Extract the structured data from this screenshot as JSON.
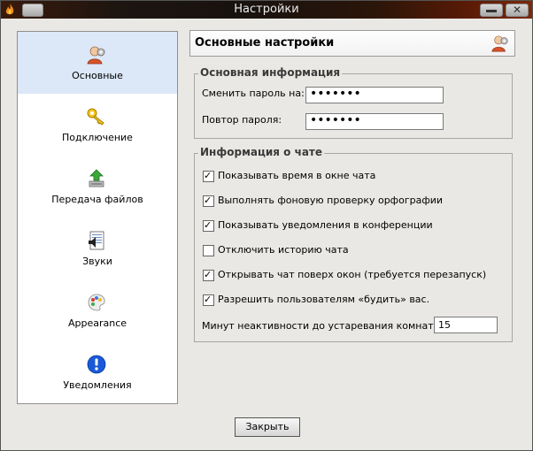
{
  "window": {
    "title": "Настройки"
  },
  "sidebar": {
    "items": [
      {
        "label": "Основные",
        "icon": "user-settings-icon",
        "active": true
      },
      {
        "label": "Подключение",
        "icon": "key-icon",
        "active": false
      },
      {
        "label": "Передача файлов",
        "icon": "file-transfer-icon",
        "active": false
      },
      {
        "label": "Звуки",
        "icon": "sound-document-icon",
        "active": false
      },
      {
        "label": "Appearance",
        "icon": "palette-icon",
        "active": false
      },
      {
        "label": "Уведомления",
        "icon": "notification-icon",
        "active": false
      }
    ]
  },
  "main": {
    "header": "Основные настройки",
    "basic_group": {
      "title": "Основная информация",
      "change_password_label": "Сменить пароль на:",
      "change_password_value": "•••••••",
      "repeat_password_label": "Повтор пароля:",
      "repeat_password_value": "•••••••"
    },
    "chat_group": {
      "title": "Информация о чате",
      "options": [
        {
          "label": "Показывать время в окне чата",
          "checked": true
        },
        {
          "label": "Выполнять фоновую проверку орфографии",
          "checked": true
        },
        {
          "label": "Показывать уведомления в конференции",
          "checked": true
        },
        {
          "label": "Отключить историю чата",
          "checked": false
        },
        {
          "label": "Открывать чат поверх окон (требуется перезапуск)",
          "checked": true
        },
        {
          "label": "Разрешить пользователям «будить» вас.",
          "checked": true
        }
      ],
      "idle_label": "Минут неактивности до устаревания комнаты:",
      "idle_value": "15"
    }
  },
  "footer": {
    "close_label": "Закрыть"
  },
  "colors": {
    "sidebar_active": "#dce7f7",
    "titlebar": "#1d1510"
  }
}
